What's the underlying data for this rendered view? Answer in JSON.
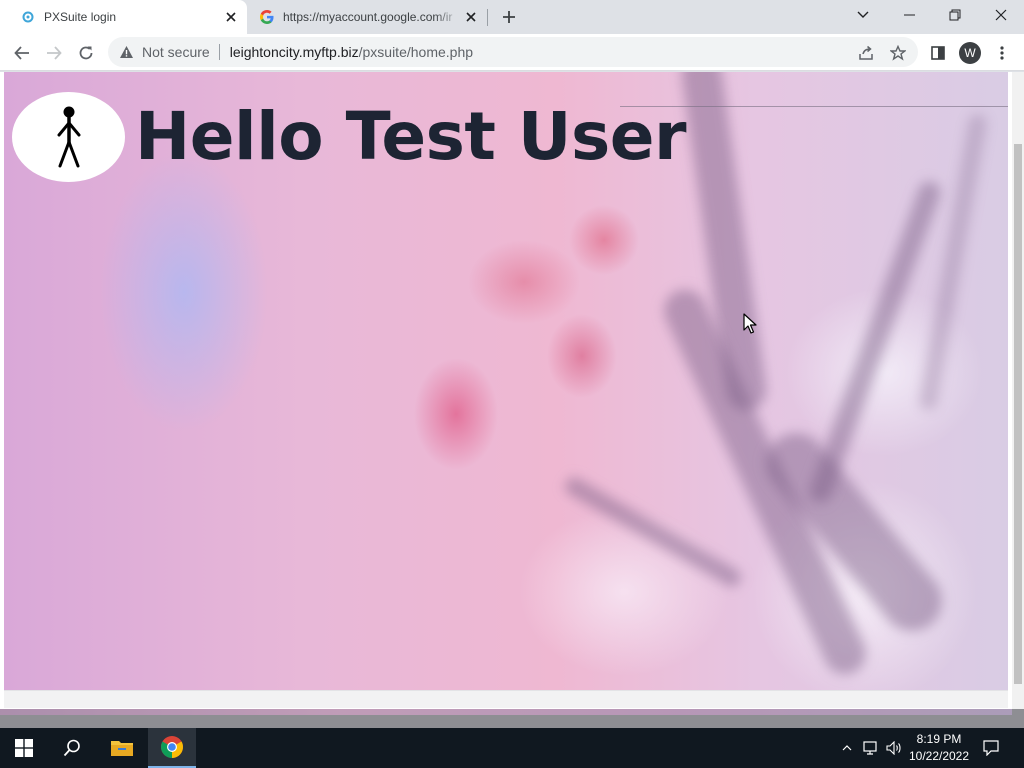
{
  "browser": {
    "tabs": [
      {
        "title": "PXSuite login",
        "active": true,
        "favicon": "pxsuite-favicon"
      },
      {
        "title": "https://myaccount.google.com/ir",
        "active": false,
        "favicon": "google-favicon"
      }
    ],
    "address_bar": {
      "security_label": "Not secure",
      "host": "leightoncity.myftp.biz",
      "path": "/pxsuite/home.php"
    },
    "profile_initial": "W"
  },
  "page": {
    "greeting": "Hello Test User",
    "logo_icon": "stick-figure-icon"
  },
  "taskbar": {
    "time": "8:19 PM",
    "date": "10/22/2022"
  },
  "colors": {
    "greeting_text": "#1d2433",
    "taskbar_bg": "#101820",
    "tab_strip_bg": "#dee1e6"
  }
}
